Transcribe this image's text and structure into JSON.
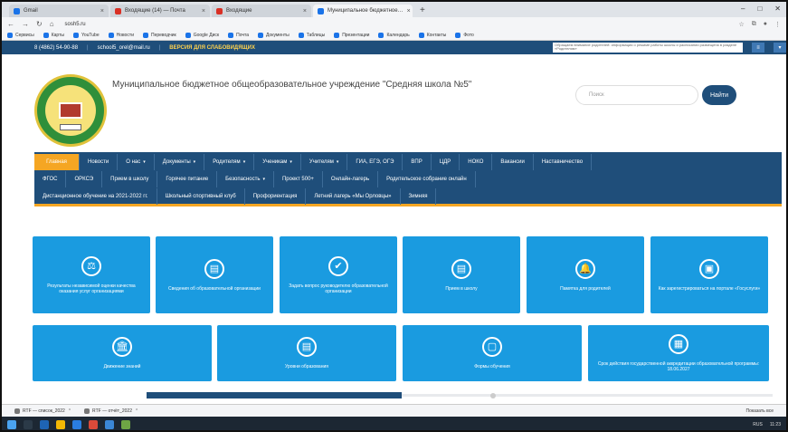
{
  "browser": {
    "tabs": [
      {
        "label": "Gmail",
        "favicon_color": "#1a73e8",
        "active": false
      },
      {
        "label": "Входящие (14) — Почта",
        "favicon_color": "#d93025",
        "active": false
      },
      {
        "label": "Входящие",
        "favicon_color": "#d93025",
        "active": false
      },
      {
        "label": "Муниципальное бюджетное…",
        "favicon_color": "#1a73e8",
        "active": true
      }
    ],
    "new_tab_symbol": "+",
    "url": "sosh5.ru",
    "window_controls": [
      "–",
      "□",
      "✕"
    ],
    "bookmarks": [
      "Сервисы",
      "Карты",
      "YouTube",
      "Новости",
      "Переводчик",
      "Google Диск",
      "Почта",
      "Документы",
      "Таблицы",
      "Презентации",
      "Календарь",
      "Контакты",
      "Фото"
    ]
  },
  "site": {
    "top_strip": {
      "phone": "8 (4862) 54-90-88",
      "email": "school5_orel@mail.ru",
      "vi_link": "ВЕРСИЯ ДЛЯ СЛАБОВИДЯЩИХ",
      "notice": "Обращаем внимание родителей: информация о режиме работы школы и расписании размещена в разделе «Родителям»"
    },
    "title": "Муниципальное бюджетное общеобразовательное учреждение \"Средняя школа №5\"",
    "search": {
      "placeholder": "Поиск",
      "button": "Найти"
    },
    "nav_rows": [
      [
        {
          "label": "Главная",
          "dropdown": false
        },
        {
          "label": "Новости",
          "dropdown": false
        },
        {
          "label": "О нас",
          "dropdown": true
        },
        {
          "label": "Документы",
          "dropdown": true
        },
        {
          "label": "Родителям",
          "dropdown": true
        },
        {
          "label": "Ученикам",
          "dropdown": true
        },
        {
          "label": "Учителям",
          "dropdown": true
        },
        {
          "label": "ГИА, ЕГЭ, ОГЭ",
          "dropdown": false
        },
        {
          "label": "ВПР",
          "dropdown": false
        },
        {
          "label": "ЦДР",
          "dropdown": false
        },
        {
          "label": "НОКО",
          "dropdown": false
        },
        {
          "label": "Вакансии",
          "dropdown": false
        },
        {
          "label": "Наставничество",
          "dropdown": false
        }
      ],
      [
        {
          "label": "ФГОС",
          "dropdown": false
        },
        {
          "label": "ОРКСЭ",
          "dropdown": false
        },
        {
          "label": "Прием в школу",
          "dropdown": false
        },
        {
          "label": "Горячее питание",
          "dropdown": false
        },
        {
          "label": "Безопасность",
          "dropdown": true
        },
        {
          "label": "Проект 500+",
          "dropdown": false
        },
        {
          "label": "Онлайн-лагерь",
          "dropdown": false
        },
        {
          "label": "Родительское собрание онлайн",
          "dropdown": false
        }
      ],
      [
        {
          "label": "Дистанционное обучение на 2021-2022 гг.",
          "dropdown": false
        },
        {
          "label": "Школьный спортивный клуб",
          "dropdown": false
        },
        {
          "label": "Профориентация",
          "dropdown": false
        },
        {
          "label": "Летний лагерь «Мы Орловцы»",
          "dropdown": false
        },
        {
          "label": "Зимняя",
          "dropdown": false
        }
      ]
    ],
    "tiles_row1": [
      {
        "label": "Результаты независимой оценки качества оказания услуг организациями",
        "icon": "scale-icon",
        "glyph": "⚖"
      },
      {
        "label": "Сведения об образовательной организации",
        "icon": "document-icon",
        "glyph": "▤"
      },
      {
        "label": "Задать вопрос руководителю образовательной организации",
        "icon": "check-icon",
        "glyph": "✔"
      },
      {
        "label": "Прием в школу",
        "icon": "file-icon",
        "glyph": "▤"
      },
      {
        "label": "Памятка для родителей",
        "icon": "bell-icon",
        "glyph": "🔔"
      },
      {
        "label": "Как зарегистрироваться на портале «Госуслуги»",
        "icon": "notebook-icon",
        "glyph": "▣"
      }
    ],
    "tiles_row2": [
      {
        "label": "Движение знаний",
        "icon": "institution-icon",
        "glyph": "🏛"
      },
      {
        "label": "Уровни образования",
        "icon": "file-icon",
        "glyph": "▤"
      },
      {
        "label": "Формы обучения",
        "icon": "page-icon",
        "glyph": "▢"
      },
      {
        "label": "Срок действия государственной аккредитации образовательной программы: 18.06.2027",
        "icon": "calendar-icon",
        "glyph": "▦"
      }
    ]
  },
  "downloads": {
    "items": [
      "RTF — список_2022",
      "RTF — отчёт_2022"
    ],
    "show_all": "Показать все"
  },
  "taskbar": {
    "tray_text": "RUS",
    "time": "11:23"
  }
}
